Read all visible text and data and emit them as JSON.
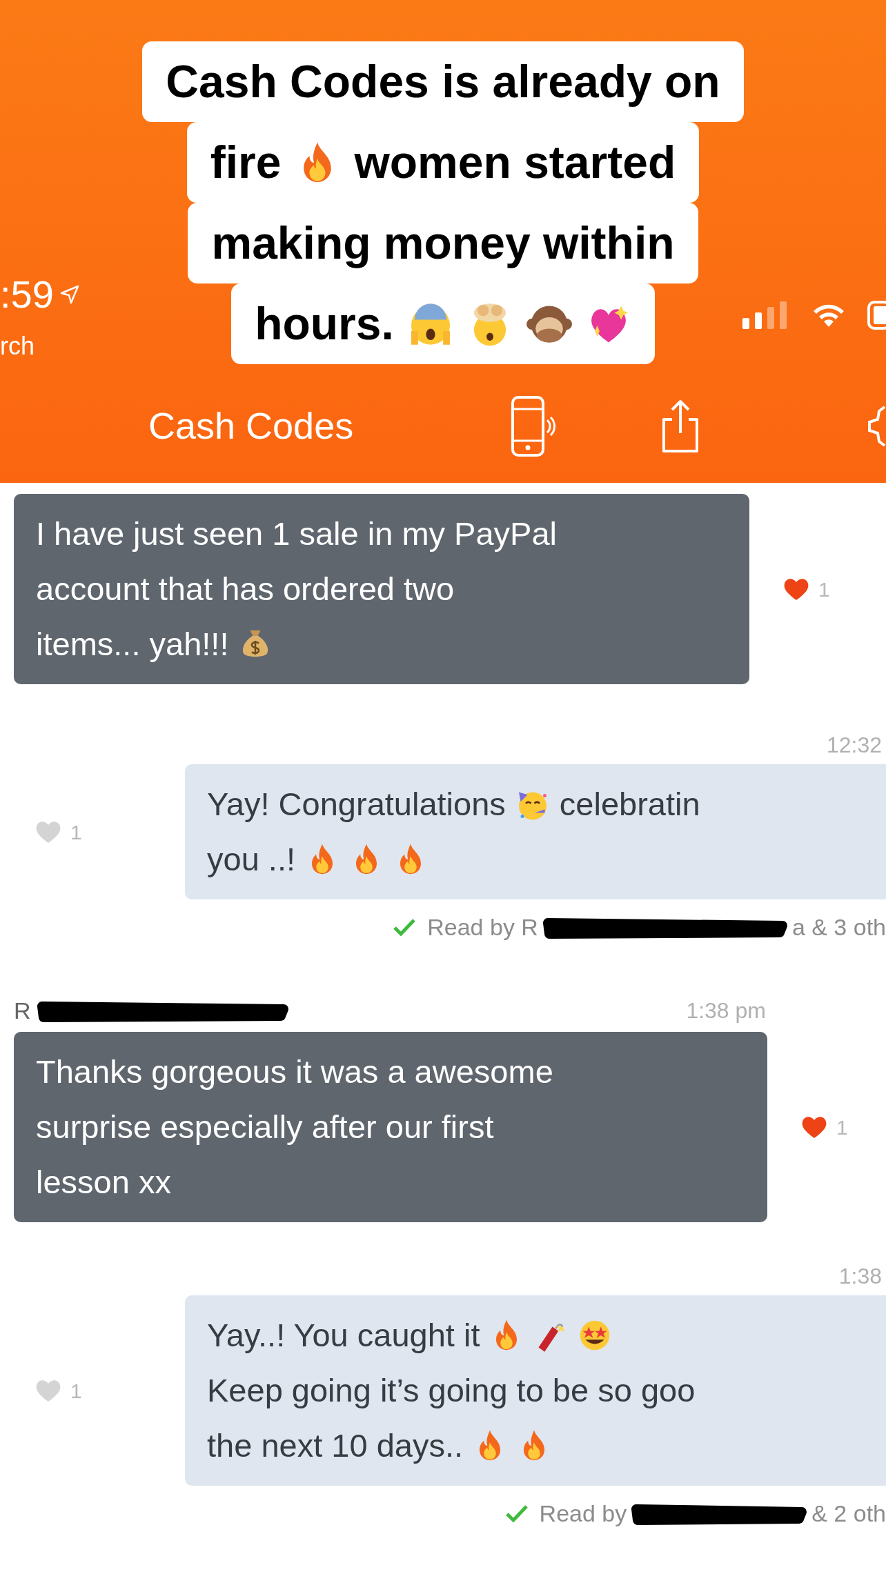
{
  "caption": {
    "lines": [
      [
        {
          "kind": "text",
          "text": "Cash Codes is already on"
        }
      ],
      [
        {
          "kind": "text",
          "text": "fire"
        },
        {
          "kind": "fire"
        },
        {
          "kind": "text",
          "text": "women started"
        }
      ],
      [
        {
          "kind": "text",
          "text": "making money within"
        }
      ],
      [
        {
          "kind": "text",
          "text": "hours."
        },
        {
          "kind": "scream"
        },
        {
          "kind": "mind-blown"
        },
        {
          "kind": "monkey"
        },
        {
          "kind": "sparkle-heart"
        }
      ]
    ]
  },
  "status_bar": {
    "time": ":59",
    "back_label": "rch"
  },
  "header": {
    "title": "Cash Codes"
  },
  "messages": [
    {
      "kind": "incoming",
      "lines": [
        [
          {
            "kind": "text",
            "text": "I have just seen 1 sale in my PayPal"
          }
        ],
        [
          {
            "kind": "text",
            "text": "account that has ordered two"
          }
        ],
        [
          {
            "kind": "text",
            "text": "items... yah!!!"
          },
          {
            "kind": "money-bag"
          }
        ]
      ],
      "reaction": {
        "liked": true,
        "count": "1"
      }
    },
    {
      "kind": "outgoing",
      "time": "12:32",
      "lines": [
        [
          {
            "kind": "text",
            "text": "Yay! Congratulations"
          },
          {
            "kind": "party-face"
          },
          {
            "kind": "text",
            "text": "celebratin"
          }
        ],
        [
          {
            "kind": "text",
            "text": "you ..!"
          },
          {
            "kind": "fire"
          },
          {
            "kind": "fire"
          },
          {
            "kind": "fire"
          }
        ]
      ],
      "reaction": {
        "liked": false,
        "count": "1"
      },
      "read_receipt": {
        "prefix": "Read by R",
        "suffix": "a & 3 oth"
      }
    },
    {
      "kind": "incoming",
      "sender": "R",
      "time": "1:38 pm",
      "lines": [
        [
          {
            "kind": "text",
            "text": "Thanks gorgeous it was a awesome"
          }
        ],
        [
          {
            "kind": "text",
            "text": "surprise especially after our first"
          }
        ],
        [
          {
            "kind": "text",
            "text": "lesson xx"
          }
        ]
      ],
      "reaction": {
        "liked": true,
        "count": "1"
      }
    },
    {
      "kind": "outgoing",
      "time": "1:38",
      "lines": [
        [
          {
            "kind": "text",
            "text": "Yay..! You caught it"
          },
          {
            "kind": "fire"
          },
          {
            "kind": "firecracker"
          },
          {
            "kind": "star-struck"
          }
        ],
        [
          {
            "kind": "text",
            "text": "Keep going it’s going to be so goo"
          }
        ],
        [
          {
            "kind": "text",
            "text": "the next 10 days.."
          },
          {
            "kind": "fire"
          },
          {
            "kind": "fire"
          }
        ]
      ],
      "reaction": {
        "liked": false,
        "count": "1"
      },
      "read_receipt": {
        "prefix": "Read by",
        "suffix": "& 2 oth"
      }
    }
  ]
}
